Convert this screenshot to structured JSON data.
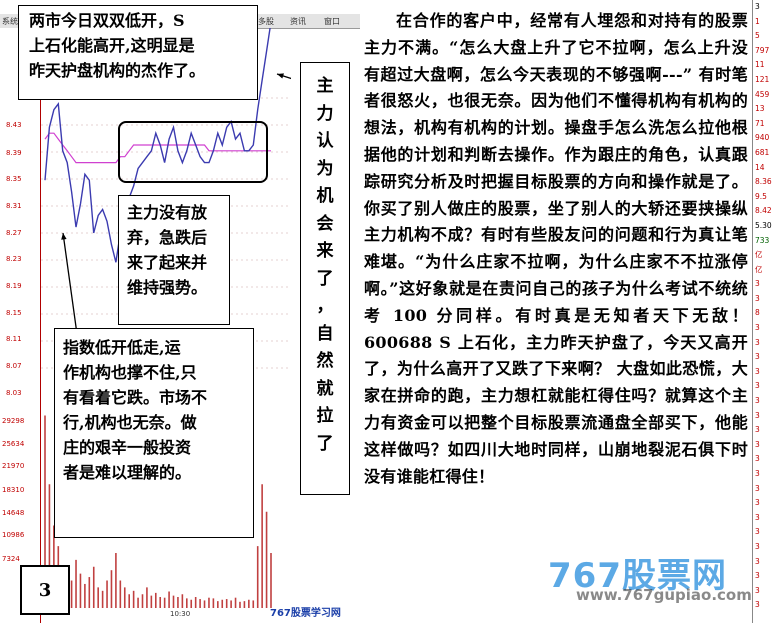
{
  "toolbar": {
    "left_label": "系统",
    "items": [
      "多股",
      "资讯",
      "窗口"
    ]
  },
  "price_axis": [
    "8.43",
    "8.39",
    "8.35",
    "8.31",
    "8.27",
    "8.23",
    "8.19",
    "8.15",
    "8.11",
    "8.07",
    "8.03"
  ],
  "volume_axis": [
    "29298",
    "25634",
    "21970",
    "18310",
    "14648",
    "10986",
    "7324"
  ],
  "time_label": "10:30",
  "annotations": {
    "top_box": [
      "两市今日双双低开，S",
      "上石化能高开,这明显是",
      "昨天护盘机构的杰作了。"
    ],
    "mid_box": [
      "主力没有放",
      "弃，急跌后",
      "来了起来并",
      "维持强势。"
    ],
    "bottom_box": [
      "指数低开低走,运",
      "作机构也撑不住,只",
      "有看着它跌。市场不",
      "行,机构也无奈。做",
      "庄的艰辛一般投资",
      "者是难以理解的。"
    ],
    "page_number": "3",
    "vertical_box": [
      "主",
      "力",
      "认",
      "为",
      "机",
      "会",
      "来",
      "了",
      "，",
      "自",
      "然",
      "就",
      "拉",
      "了"
    ]
  },
  "article": {
    "paragraph": "在合作的客户中，经常有人埋怨和对持有的股票主力不满。“怎么大盘上升了它不拉啊，怎么上升没有超过大盘啊，怎么今天表现的不够强啊---” 有时笔者很怒火，也很无奈。因为他们不懂得机构有机构的想法，机构有机构的计划。操盘手怎么洗怎么拉他根据他的计划和判断去操作。作为跟庄的角色，认真跟踪研究分析及时把握目标股票的方向和操作就是了。 你买了别人做庄的股票，坐了别人的大轿还要挟操纵主力机构不成？有时有些股友问的问题和行为真让笔难堪。“为什么庄家不拉啊，为什么庄家不不拉涨停啊。”这好象就是在责问自己的孩子为什么考试不统统考 100 分同样。有时真是无知者天下无敌！ 600688 S 上石化，主力昨天护盘了，今天又高开了，为什么高开了又跌了下来啊？ 大盘如此恐慌，大家在拼命的跑，主力想杠就能杠得住吗？就算这个主力有资金可以把整个目标股票流通盘全部买下，他能这样做吗？如四川大地时同样，山崩地裂泥石俱下时没有谁能杠得住！"
  },
  "right_strip": [
    "3",
    "1",
    "5",
    "797",
    "11",
    "121",
    "459",
    "13",
    "71",
    "940",
    "681",
    "14",
    "8.36",
    "9.5",
    "8.42",
    "5.30",
    "733",
    "亿",
    "亿",
    "3",
    "3",
    "8",
    "3",
    "3",
    "3",
    "3",
    "3",
    "3",
    "3",
    "3",
    "3",
    "3",
    "3",
    "3",
    "3",
    "3",
    "3",
    "3",
    "3",
    "3",
    "3",
    "3"
  ],
  "watermark": {
    "brand": "767股票网",
    "url": "www.767gupiao.com",
    "footer": "767股票学习网"
  },
  "colors": {
    "price_line": "#3b3bb0",
    "avg_line": "#d040d0",
    "axis_red": "#c00000",
    "volume": "#c04040"
  },
  "chart_data": {
    "type": "line",
    "x_range_label": "10:30",
    "ylim": [
      8.01,
      8.47
    ],
    "price_series": [
      8.33,
      8.42,
      8.45,
      8.46,
      8.38,
      8.36,
      8.31,
      8.25,
      8.29,
      8.34,
      8.33,
      8.24,
      8.27,
      8.28,
      8.26,
      8.22,
      8.19,
      8.24,
      8.29,
      8.3,
      8.32,
      8.35,
      8.36,
      8.37,
      8.38,
      8.41,
      8.39,
      8.36,
      8.4,
      8.42,
      8.38,
      8.36,
      8.38,
      8.41,
      8.39,
      8.37,
      8.36,
      8.36,
      8.38,
      8.41,
      8.39,
      8.42,
      8.43,
      8.4,
      8.41,
      8.38,
      8.38,
      8.39,
      8.45,
      8.5,
      8.55,
      8.6
    ],
    "avg_series": [
      8.4,
      8.41,
      8.41,
      8.4,
      8.39,
      8.38,
      8.37,
      8.36,
      8.36,
      8.36,
      8.36,
      8.36,
      8.36,
      8.36,
      8.36,
      8.36,
      8.36,
      8.37,
      8.37,
      8.38,
      8.39,
      8.39,
      8.39,
      8.39,
      8.39,
      8.39,
      8.39,
      8.39,
      8.39,
      8.39,
      8.39,
      8.39,
      8.39,
      8.39,
      8.39,
      8.39,
      8.39,
      8.38,
      8.38,
      8.38,
      8.38,
      8.38,
      8.38,
      8.38,
      8.38,
      8.38,
      8.38,
      8.38,
      8.38,
      8.38,
      8.38,
      8.38
    ],
    "volume_ylim": [
      0,
      32000
    ],
    "volume_series": [
      28000,
      18000,
      12000,
      9000,
      6000,
      5000,
      4000,
      7000,
      5000,
      3500,
      4500,
      6000,
      3000,
      2500,
      4000,
      5500,
      8000,
      4000,
      3000,
      2000,
      2500,
      1500,
      2000,
      3000,
      1800,
      2200,
      1600,
      1500,
      2400,
      1800,
      1600,
      2000,
      1400,
      1200,
      1600,
      1300,
      1100,
      1500,
      1400,
      1000,
      1200,
      1300,
      1100,
      1500,
      900,
      1000,
      1200,
      1100,
      9000,
      18000,
      14000,
      8000
    ]
  }
}
